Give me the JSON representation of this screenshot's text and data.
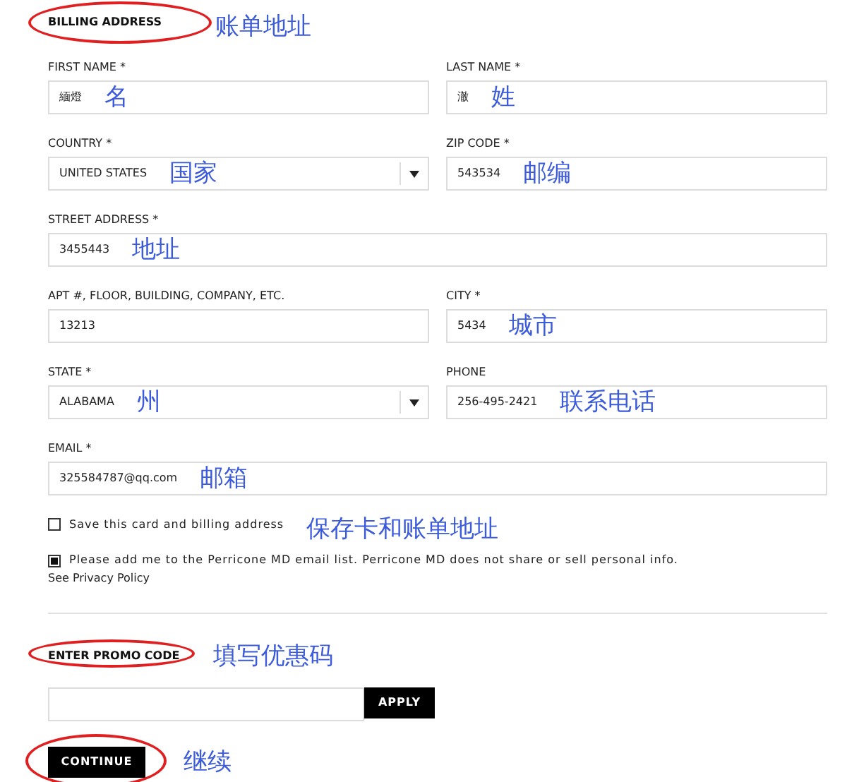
{
  "billing": {
    "heading": "BILLING ADDRESS",
    "circled": true,
    "annotation": "账单地址"
  },
  "rows": [
    [
      {
        "label": "FIRST NAME *",
        "value": "緬燈",
        "kind": "text",
        "annotation": "名"
      },
      {
        "label": "LAST NAME *",
        "value": "澈",
        "kind": "text",
        "annotation": "姓"
      }
    ],
    [
      {
        "label": "COUNTRY *",
        "value": "UNITED STATES",
        "kind": "select",
        "annotation": "国家"
      },
      {
        "label": "ZIP CODE *",
        "value": "543534",
        "kind": "text",
        "annotation": "邮编"
      }
    ],
    [
      {
        "label": "STREET ADDRESS *",
        "value": "3455443",
        "kind": "text",
        "annotation": "地址"
      }
    ],
    [
      {
        "label": "APT #, FLOOR, BUILDING, COMPANY, ETC.",
        "value": "13213",
        "kind": "text"
      },
      {
        "label": "CITY *",
        "value": "5434",
        "kind": "text",
        "annotation": "城市"
      }
    ],
    [
      {
        "label": "STATE *",
        "value": "ALABAMA",
        "kind": "select",
        "annotation": "州"
      },
      {
        "label": "PHONE",
        "value": "256-495-2421",
        "kind": "text",
        "annotation": "联系电话"
      }
    ],
    [
      {
        "label": "EMAIL *",
        "value": "325584787@qq.com",
        "kind": "text",
        "annotation": "邮箱"
      }
    ]
  ],
  "checkboxes": [
    {
      "label": "Save this card and billing address",
      "checked": false,
      "annotation": "保存卡和账单地址"
    },
    {
      "label": "Please add me to the Perricone MD email list. Perricone MD does not share or sell personal info.",
      "checked": true
    }
  ],
  "privacy_link": "See Privacy Policy",
  "promo": {
    "heading": "ENTER PROMO CODE",
    "circled": true,
    "annotation": "填写优惠码",
    "button": "APPLY"
  },
  "continue": {
    "label": "CONTINUE",
    "circled": true,
    "annotation": "继续"
  }
}
